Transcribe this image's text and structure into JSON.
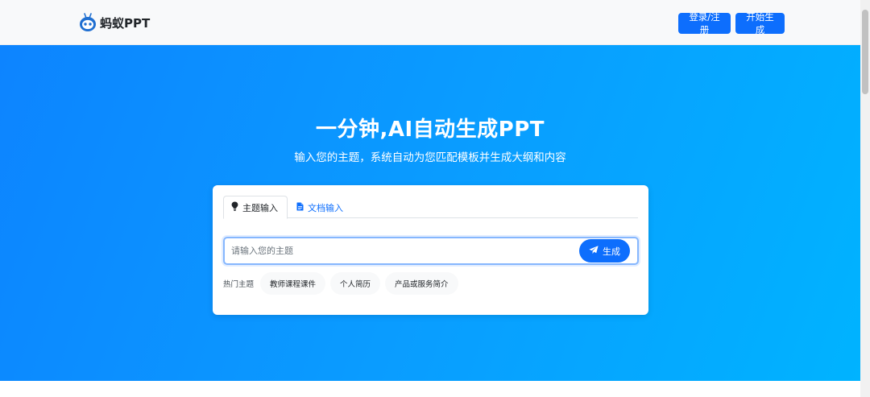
{
  "header": {
    "logo_text": "蚂蚁PPT",
    "login_button": "登录/注册",
    "start_button": "开始生成"
  },
  "hero": {
    "title": "一分钟,AI自动生成PPT",
    "subtitle": "输入您的主题，系统自动为您匹配模板并生成大纲和内容"
  },
  "card": {
    "tabs": [
      {
        "label": "主题输入",
        "icon": "lightbulb-icon",
        "active": true
      },
      {
        "label": "文档输入",
        "icon": "file-icon",
        "active": false
      }
    ],
    "search": {
      "placeholder": "请输入您的主题",
      "value": "",
      "submit_label": "生成"
    },
    "hot_topics": {
      "label": "热门主题",
      "items": [
        "教师课程课件",
        "个人简历",
        "产品或服务简介"
      ]
    }
  },
  "colors": {
    "primary": "#0d6efd",
    "hero_gradient_start": "#0d84ff",
    "hero_gradient_end": "#00b3ff"
  }
}
